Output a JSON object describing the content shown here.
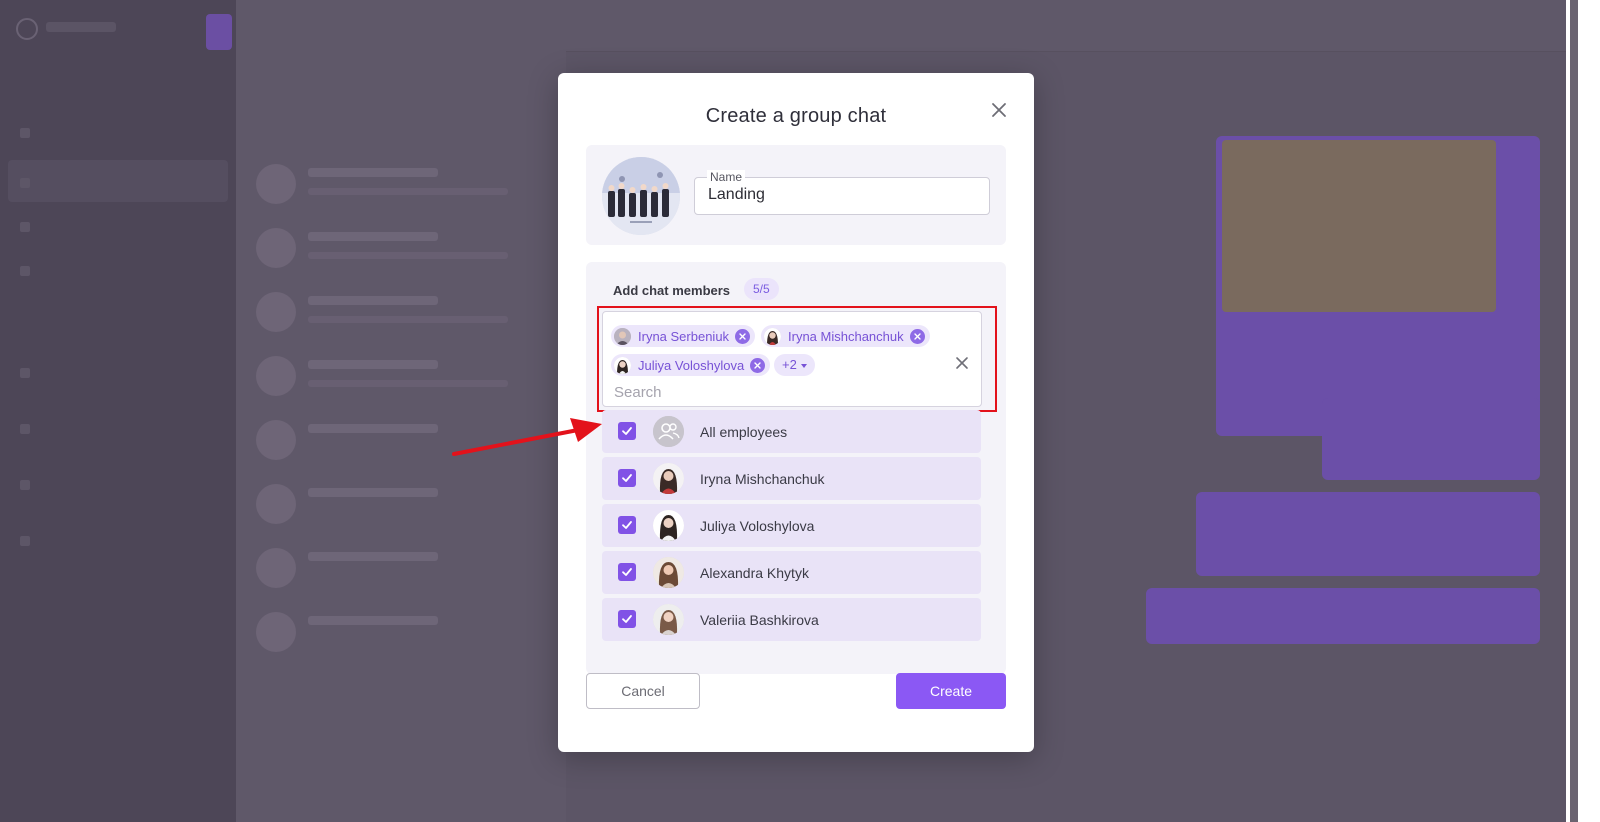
{
  "modal": {
    "title": "Create a group chat",
    "name_label": "Name",
    "name_value": "Landing",
    "members_heading": "Add chat members",
    "members_count": "5/5",
    "search_placeholder": "Search",
    "more_chip": "+2",
    "cancel_label": "Cancel",
    "create_label": "Create"
  },
  "selected_chips": [
    {
      "label": "Iryna Serbeniuk"
    },
    {
      "label": "Iryna Mishchanchuk"
    },
    {
      "label": "Juliya Voloshylova"
    }
  ],
  "members": [
    {
      "name": "All employees",
      "checked": true,
      "icon": "group-icon"
    },
    {
      "name": "Iryna Mishchanchuk",
      "checked": true
    },
    {
      "name": "Juliya Voloshylova",
      "checked": true
    },
    {
      "name": "Alexandra Khytyk",
      "checked": true
    },
    {
      "name": "Valeriia Bashkirova",
      "checked": true
    }
  ],
  "colors": {
    "accent": "#8b58f4",
    "chip_bg": "#ece6fb",
    "highlight": "#e3121b",
    "overlay": "#5c5566"
  }
}
